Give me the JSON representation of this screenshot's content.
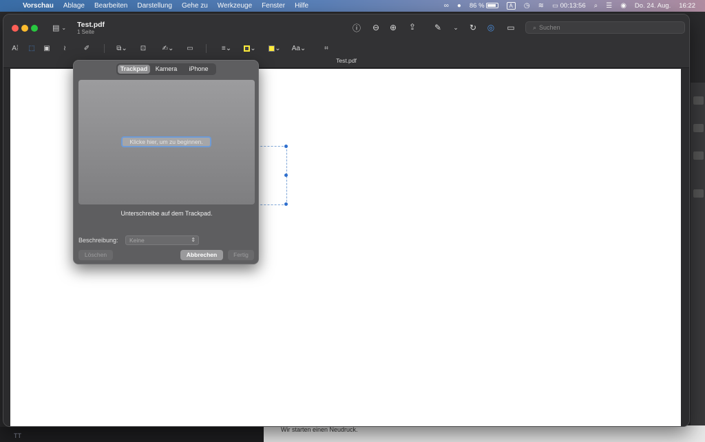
{
  "menubar": {
    "apple_glyph": "",
    "app_name": "Vorschau",
    "items": [
      "Ablage",
      "Bearbeiten",
      "Darstellung",
      "Gehe zu",
      "Werkzeuge",
      "Fenster",
      "Hilfe"
    ],
    "battery_percent": "86 %",
    "battery_level": 0.86,
    "keyboard_indicator": "A",
    "timer": "00:13:56",
    "date": "Do. 24. Aug.",
    "time": "16:22"
  },
  "window": {
    "title": "Test.pdf",
    "subtitle": "1 Seite",
    "filename_bar": "Test.pdf",
    "search_placeholder": "Suchen"
  },
  "signature_popover": {
    "tabs": [
      {
        "label": "Trackpad",
        "active": true
      },
      {
        "label": "Kamera",
        "active": false
      },
      {
        "label": "iPhone",
        "active": false
      }
    ],
    "click_hint": "Klicke hier, um zu beginnen.",
    "instruction": "Unterschreibe auf dem Trackpad.",
    "description_label": "Beschreibung:",
    "description_value": "Keine",
    "clear_label": "Löschen",
    "cancel_label": "Abbrechen",
    "done_label": "Fertig"
  },
  "background": {
    "bottom_text": "Wir starten einen Neudruck.",
    "sidebar_text": "TT"
  },
  "colors": {
    "accent": "#2f6fce",
    "highlight_yellow": "#ffeb3b"
  }
}
